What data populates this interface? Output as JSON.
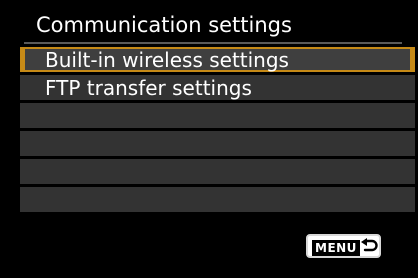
{
  "title": "Communication settings",
  "menu": {
    "items": [
      {
        "label": "Built-in wireless settings",
        "selected": true
      },
      {
        "label": "FTP transfer settings",
        "selected": false
      },
      {
        "label": "",
        "selected": false
      },
      {
        "label": "",
        "selected": false
      },
      {
        "label": "",
        "selected": false
      },
      {
        "label": "",
        "selected": false
      }
    ]
  },
  "footer": {
    "menu_button_label": "MENU",
    "return_icon": "return-arrow-icon"
  },
  "colors": {
    "background": "#000000",
    "row": "#333333",
    "selection_border": "#c68a17",
    "text": "#ffffff"
  }
}
